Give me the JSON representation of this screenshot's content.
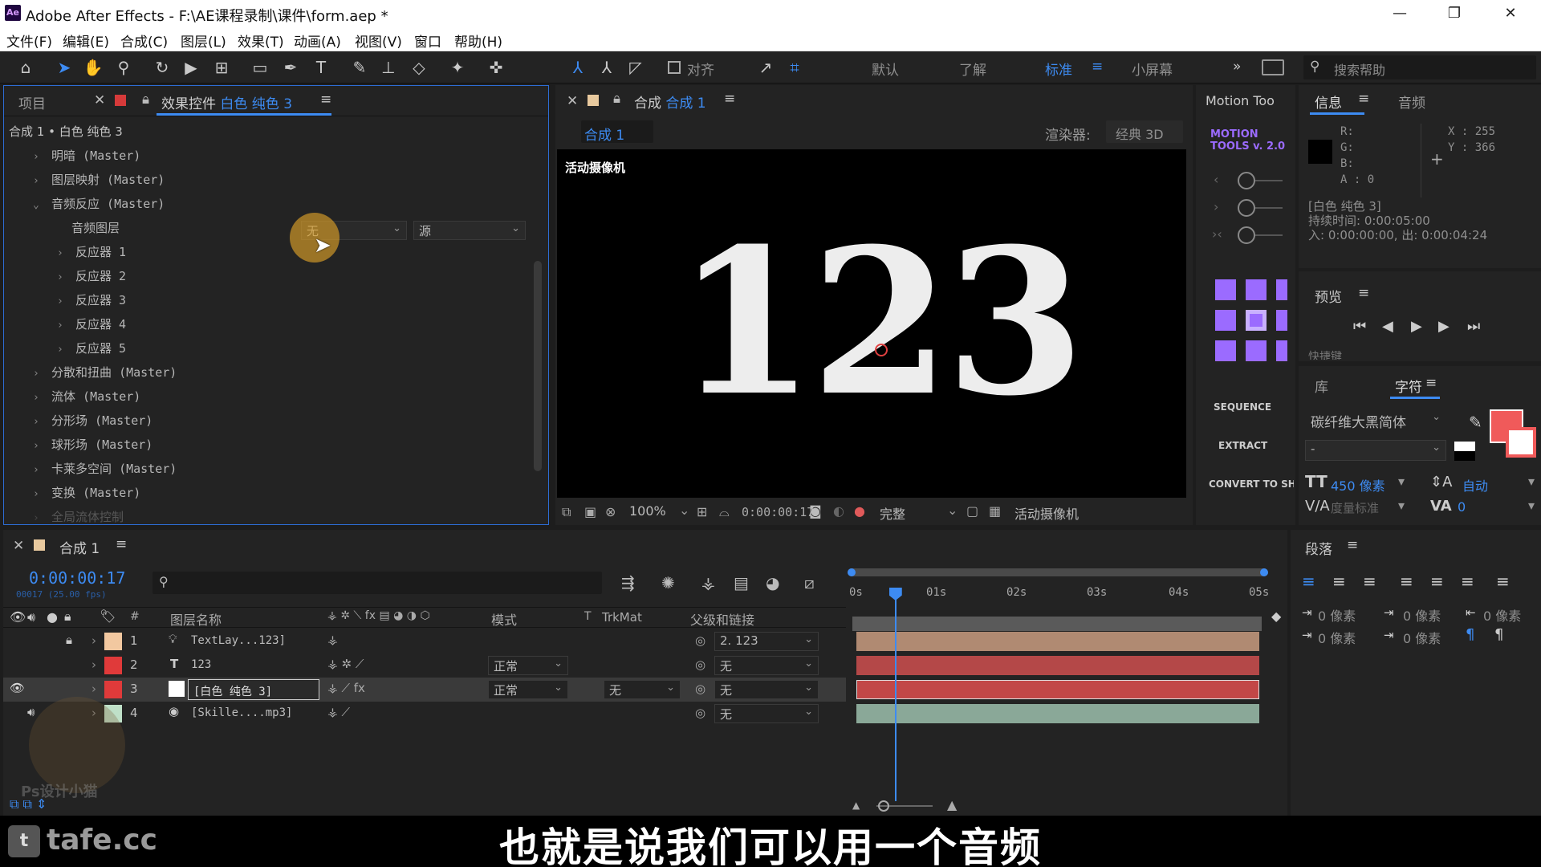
{
  "window": {
    "title": "Adobe After Effects - F:\\AE课程录制\\课件\\form.aep *",
    "logo": "Ae"
  },
  "menu": [
    "文件(F)",
    "编辑(E)",
    "合成(C)",
    "图层(L)",
    "效果(T)",
    "动画(A)",
    "视图(V)",
    "窗口",
    "帮助(H)"
  ],
  "toolbar": {
    "snap_label": "对齐",
    "workspaces": [
      "默认",
      "了解",
      "标准",
      "小屏幕"
    ],
    "active_workspace": "标准",
    "overflow": "»",
    "search_placeholder": "搜索帮助"
  },
  "left_panel": {
    "tab_project": "项目",
    "tab_effects_prefix": "效果控件",
    "tab_effects_layer": "白色 纯色 3",
    "breadcrumb": "合成 1 • 白色 纯色 3",
    "items": [
      {
        "label": "明暗 (Master)",
        "indent": 0,
        "open": false
      },
      {
        "label": "图层映射 (Master)",
        "indent": 0,
        "open": false
      },
      {
        "label": "音频反应 (Master)",
        "indent": 0,
        "open": true
      },
      {
        "label": "音频图层",
        "indent": 1,
        "open": null
      },
      {
        "label": "反应器 1",
        "indent": 1,
        "open": false
      },
      {
        "label": "反应器 2",
        "indent": 1,
        "open": false
      },
      {
        "label": "反应器 3",
        "indent": 1,
        "open": false
      },
      {
        "label": "反应器 4",
        "indent": 1,
        "open": false
      },
      {
        "label": "反应器 5",
        "indent": 1,
        "open": false
      },
      {
        "label": "分散和扭曲 (Master)",
        "indent": 0,
        "open": false
      },
      {
        "label": "流体 (Master)",
        "indent": 0,
        "open": false
      },
      {
        "label": "分形场 (Master)",
        "indent": 0,
        "open": false
      },
      {
        "label": "球形场 (Master)",
        "indent": 0,
        "open": false
      },
      {
        "label": "卡莱多空间 (Master)",
        "indent": 0,
        "open": false
      },
      {
        "label": "变换 (Master)",
        "indent": 0,
        "open": false
      },
      {
        "label": "全局流体控制",
        "indent": 0,
        "open": false
      }
    ],
    "audio_layer_value": "无",
    "audio_source_value": "源"
  },
  "comp_panel": {
    "tab_prefix": "合成",
    "tab_name": "合成 1",
    "subtab": "合成 1",
    "renderer_label": "渲染器:",
    "renderer_value": "经典 3D",
    "camera_label": "活动摄像机",
    "viewer_text": "123",
    "zoom": "100%",
    "timecode": "0:00:00:17",
    "quality": "完整",
    "view": "活动摄像机"
  },
  "motion_tools": {
    "title": "Motion Too",
    "logo_line1": "MOTION",
    "logo_line2": "TOOLS v. 2.0",
    "buttons": [
      "SEQUENCE",
      "EXTRACT",
      "CONVERT TO SH"
    ]
  },
  "info_panel": {
    "tab_info": "信息",
    "tab_audio": "音频",
    "r": "R:",
    "g": "G:",
    "b": "B:",
    "a": "A : 0",
    "x": "X : 255",
    "y": "Y : 366",
    "layer_name": "[白色 纯色 3]",
    "duration": "持续时间: 0:00:05:00",
    "in_out": "入: 0:00:00:00, 出: 0:00:04:24"
  },
  "preview_panel": {
    "title": "预览",
    "truncated_label": "快捷键"
  },
  "character_panel": {
    "tab_library": "库",
    "tab_character": "字符",
    "font": "碳纤维大黑简体",
    "style": "-",
    "size": "450 像素",
    "leading": "自动",
    "kerning": "度量标准",
    "tracking": "0",
    "fill_color": "#f05a5a"
  },
  "paragraph_panel": {
    "title": "段落",
    "indent_values": [
      "0 像素",
      "0 像素",
      "0 像素",
      "0 像素",
      "0 像素"
    ]
  },
  "timeline": {
    "tab_name": "合成 1",
    "timecode": "0:00:00:17",
    "frame_info": "00017 (25.00 fps)",
    "ruler": [
      "0s",
      "01s",
      "02s",
      "03s",
      "04s",
      "05s"
    ],
    "playhead_fraction": 0.113,
    "headers": {
      "num": "#",
      "name": "图层名称",
      "mode": "模式",
      "t": "T",
      "trkmat": "TrkMat",
      "parent": "父级和链接"
    },
    "layers": [
      {
        "num": "1",
        "name": "TextLay...123]",
        "mode": "",
        "trkmat": "",
        "parent": "2. 123",
        "label_color": "#f2c8a0",
        "bar_color": "#b08a72",
        "icon": "bulb-icon"
      },
      {
        "num": "2",
        "name": "123",
        "mode": "正常",
        "trkmat": "",
        "parent": "无",
        "label_color": "#e03a3a",
        "bar_color": "#b44848",
        "icon": "text-icon"
      },
      {
        "num": "3",
        "name": "[白色 纯色 3]",
        "mode": "正常",
        "trkmat": "无",
        "parent": "无",
        "label_color": "#e03a3a",
        "bar_color": "#c24747",
        "icon": "solid-icon"
      },
      {
        "num": "4",
        "name": "[Skille....mp3]",
        "mode": "",
        "trkmat": "",
        "parent": "无",
        "label_color": "#bfe0c8",
        "bar_color": "#8aa898",
        "icon": "audio-icon"
      }
    ]
  },
  "watermark": {
    "brand": "tafe.cc",
    "ps_text": "Ps设计小猫"
  },
  "subtitle": "也就是说我们可以用一个音频"
}
